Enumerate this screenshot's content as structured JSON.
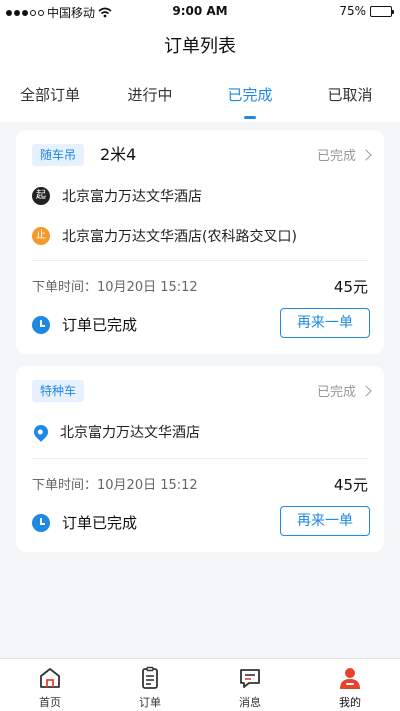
{
  "status_bar": {
    "carrier": "中国移动",
    "time": "9:00 AM",
    "battery": "75%"
  },
  "title": "订单列表",
  "tabs": [
    {
      "label": "全部订单",
      "active": false
    },
    {
      "label": "进行中",
      "active": false
    },
    {
      "label": "已完成",
      "active": true
    },
    {
      "label": "已取消",
      "active": false
    }
  ],
  "orders": [
    {
      "tag": "随车吊",
      "vehicle": "2米4",
      "status": "已完成",
      "start_badge": "起",
      "start": "北京富力万达文华酒店",
      "stop_badge": "止",
      "end": "北京富力万达文华酒店(农科路交叉口)",
      "time_label": "下单时间：",
      "time": "10月20日 15:12",
      "price": "45元",
      "done_text": "订单已完成",
      "again_label": "再来一单"
    },
    {
      "tag": "特种车",
      "status": "已完成",
      "location": "北京富力万达文华酒店",
      "time_label": "下单时间：",
      "time": "10月20日 15:12",
      "price": "45元",
      "done_text": "订单已完成",
      "again_label": "再来一单"
    }
  ],
  "bottom_nav": [
    {
      "label": "首页",
      "icon": "home-icon"
    },
    {
      "label": "订单",
      "icon": "order-icon"
    },
    {
      "label": "消息",
      "icon": "message-icon"
    },
    {
      "label": "我的",
      "icon": "profile-icon",
      "active": true
    }
  ],
  "colors": {
    "accent": "#1e88e5",
    "brand_red": "#e8412c",
    "stop_orange": "#f29b2b"
  }
}
